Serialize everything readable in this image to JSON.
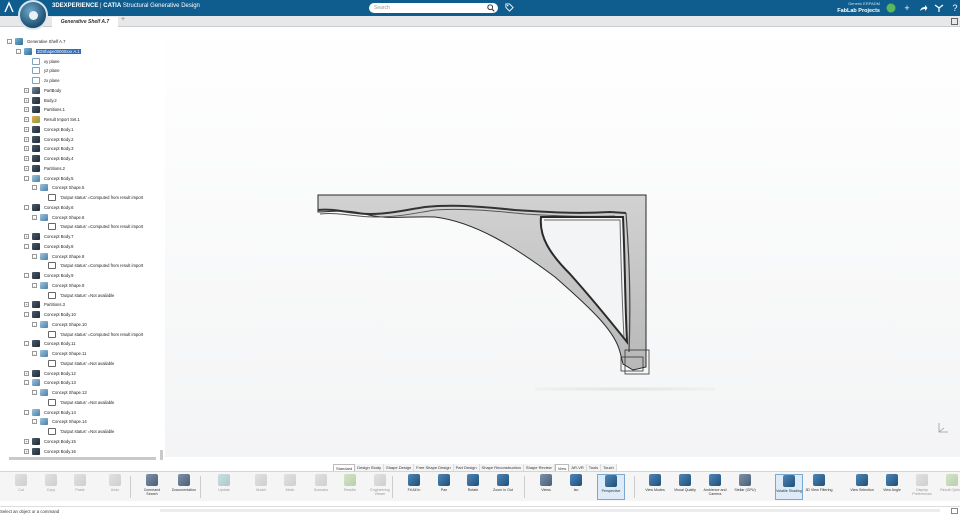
{
  "app": {
    "brand": "3DEXPERIENCE",
    "separator": " | ",
    "product": "CATIA",
    "role": "Structural Generative Design"
  },
  "search": {
    "placeholder": "Search"
  },
  "user": {
    "line1": "Generic ERPADM",
    "workspace": "FabLab Projects"
  },
  "document_tab": {
    "label": "Generative Shelf A.7"
  },
  "tree": [
    {
      "label": "Generative Shelf A.7",
      "icon": "product",
      "level": 0,
      "expander": "-"
    },
    {
      "label": "3DShape00000xxx A.1",
      "icon": "product",
      "level": 1,
      "expander": "-",
      "selected": true
    },
    {
      "label": "xy plane",
      "icon": "plane",
      "level": 2
    },
    {
      "label": "yz plane",
      "icon": "plane",
      "level": 2
    },
    {
      "label": "zx plane",
      "icon": "plane",
      "level": 2
    },
    {
      "label": "PartBody",
      "icon": "partbody",
      "level": 2,
      "expander": "+"
    },
    {
      "label": "Body.2",
      "icon": "body",
      "level": 2,
      "expander": "+"
    },
    {
      "label": "Partitions.1",
      "icon": "body",
      "level": 2,
      "expander": "+"
    },
    {
      "label": "Result Import Set.1",
      "icon": "result",
      "level": 2,
      "expander": "+"
    },
    {
      "label": "Concept Body.1",
      "icon": "body",
      "level": 2,
      "expander": "+"
    },
    {
      "label": "Concept Body.2",
      "icon": "body",
      "level": 2,
      "expander": "+"
    },
    {
      "label": "Concept Body.3",
      "icon": "body",
      "level": 2,
      "expander": "+"
    },
    {
      "label": "Concept Body.4",
      "icon": "body",
      "level": 2,
      "expander": "+"
    },
    {
      "label": "Partitions.2",
      "icon": "body",
      "level": 2,
      "expander": "+"
    },
    {
      "label": "Concept Body.5",
      "icon": "shape",
      "level": 2,
      "expander": "-"
    },
    {
      "label": "Concept Shape.5",
      "icon": "shape",
      "level": 3,
      "expander": "-"
    },
    {
      "label": "'Output status' =Computed from result import",
      "icon": "param",
      "level": 4
    },
    {
      "label": "Concept Body.6",
      "icon": "body",
      "level": 2,
      "expander": "-"
    },
    {
      "label": "Concept Shape.6",
      "icon": "shape",
      "level": 3,
      "expander": "-"
    },
    {
      "label": "'Output status' =Computed from result import",
      "icon": "param",
      "level": 4
    },
    {
      "label": "Concept Body.7",
      "icon": "body",
      "level": 2,
      "expander": "+"
    },
    {
      "label": "Concept Body.8",
      "icon": "body",
      "level": 2,
      "expander": "-"
    },
    {
      "label": "Concept Shape.8",
      "icon": "shape",
      "level": 3,
      "expander": "-"
    },
    {
      "label": "'Output status' =Computed from result import",
      "icon": "param",
      "level": 4
    },
    {
      "label": "Concept Body.9",
      "icon": "body",
      "level": 2,
      "expander": "-"
    },
    {
      "label": "Concept Shape.9",
      "icon": "shape",
      "level": 3,
      "expander": "-"
    },
    {
      "label": "'Output status' =Not available",
      "icon": "param",
      "level": 4
    },
    {
      "label": "Partitions.3",
      "icon": "body",
      "level": 2,
      "expander": "+"
    },
    {
      "label": "Concept Body.10",
      "icon": "body",
      "level": 2,
      "expander": "-"
    },
    {
      "label": "Concept Shape.10",
      "icon": "shape",
      "level": 3,
      "expander": "-"
    },
    {
      "label": "'Output status' =Computed from result import",
      "icon": "param",
      "level": 4
    },
    {
      "label": "Concept Body.11",
      "icon": "body",
      "level": 2,
      "expander": "-"
    },
    {
      "label": "Concept Shape.11",
      "icon": "shape",
      "level": 3,
      "expander": "-"
    },
    {
      "label": "'Output status' =Not available",
      "icon": "param",
      "level": 4
    },
    {
      "label": "Concept Body.12",
      "icon": "body",
      "level": 2,
      "expander": "+"
    },
    {
      "label": "Concept Body.13",
      "icon": "shape",
      "level": 2,
      "expander": "-"
    },
    {
      "label": "Concept Shape.13",
      "icon": "shape",
      "level": 3,
      "expander": "-"
    },
    {
      "label": "'Output status' =Not available",
      "icon": "param",
      "level": 4
    },
    {
      "label": "Concept Body.14",
      "icon": "shape",
      "level": 2,
      "expander": "-"
    },
    {
      "label": "Concept Shape.14",
      "icon": "shape",
      "level": 3,
      "expander": "-"
    },
    {
      "label": "'Output status' =Not available",
      "icon": "param",
      "level": 4
    },
    {
      "label": "Concept Body.15",
      "icon": "body",
      "level": 2,
      "expander": "+"
    },
    {
      "label": "Concept Body.16",
      "icon": "body",
      "level": 2,
      "expander": "+"
    }
  ],
  "workbench_tabs": [
    {
      "label": "Standard",
      "active": true
    },
    {
      "label": "Design Study"
    },
    {
      "label": "Shape Design"
    },
    {
      "label": "Free Shape Design"
    },
    {
      "label": "Part Design"
    },
    {
      "label": "Shape Reconstruction"
    },
    {
      "label": "Shape Review"
    },
    {
      "label": "View",
      "active": true
    },
    {
      "label": "AR-VR"
    },
    {
      "label": "Tools"
    },
    {
      "label": "Touch"
    }
  ],
  "toolbar": [
    {
      "label": "Cut",
      "icon": "scissors-icon",
      "color": "gray",
      "disabled": true
    },
    {
      "label": "Copy",
      "icon": "copy-icon",
      "color": "gray",
      "disabled": true
    },
    {
      "label": "Paste",
      "icon": "paste-icon",
      "color": "gray",
      "disabled": true
    },
    {
      "label": "Undo",
      "icon": "undo-icon",
      "color": "gray",
      "disabled": true
    },
    {
      "label": "Command Search",
      "icon": "command-search-icon",
      "color": "doc"
    },
    {
      "label": "Documentation",
      "icon": "book-icon",
      "color": "doc"
    },
    {
      "label": "Update",
      "icon": "update-icon",
      "color": "teal",
      "disabled": true
    },
    {
      "label": "Model",
      "icon": "model-icon",
      "color": "gray",
      "disabled": true
    },
    {
      "label": "Mesh",
      "icon": "mesh-icon",
      "color": "gray",
      "disabled": true
    },
    {
      "label": "Scenario",
      "icon": "scenario-icon",
      "color": "gray",
      "disabled": true
    },
    {
      "label": "Results",
      "icon": "results-icon",
      "color": "green",
      "disabled": true
    },
    {
      "label": "Engineering Viewer",
      "icon": "viewer-icon",
      "color": "gray",
      "disabled": true
    },
    {
      "label": "Fit All In",
      "icon": "fit-all-icon",
      "color": "blue"
    },
    {
      "label": "Pan",
      "icon": "pan-icon",
      "color": "blue"
    },
    {
      "label": "Rotate",
      "icon": "rotate-icon",
      "color": "blue"
    },
    {
      "label": "Zoom In Out",
      "icon": "zoom-icon",
      "color": "blue"
    },
    {
      "label": "Views",
      "icon": "views-icon",
      "color": "doc"
    },
    {
      "label": "Iso",
      "icon": "iso-icon",
      "color": "blue"
    },
    {
      "label": "Perspective",
      "icon": "perspective-icon",
      "color": "blue",
      "active": true
    },
    {
      "label": "View Modes",
      "icon": "view-modes-icon",
      "color": "blue"
    },
    {
      "label": "Visual Quality",
      "icon": "visual-quality-icon",
      "color": "blue"
    },
    {
      "label": "Ambience and Camera",
      "icon": "ambience-icon",
      "color": "blue"
    },
    {
      "label": "Stellar (GPU)",
      "icon": "stellar-icon",
      "color": "doc"
    },
    {
      "label": "Volatile Shading",
      "icon": "volatile-shading-icon",
      "color": "blue",
      "active": true
    },
    {
      "label": "3D View Filtering",
      "icon": "filter-icon",
      "color": "blue"
    },
    {
      "label": "View Selection",
      "icon": "view-selection-icon",
      "color": "blue"
    },
    {
      "label": "View Angle",
      "icon": "view-angle-icon",
      "color": "blue"
    },
    {
      "label": "Display Preferences",
      "icon": "preferences-icon",
      "color": "gray",
      "disabled": true
    },
    {
      "label": "Result Options",
      "icon": "result-options-icon",
      "color": "green",
      "disabled": true
    }
  ],
  "status": {
    "prompt": "Select an object or a command"
  },
  "colors": {
    "topbar": "#0f5d8f",
    "selection": "#2a6fbf",
    "model_fill": "#c8c8c8",
    "model_edge": "#333333"
  }
}
